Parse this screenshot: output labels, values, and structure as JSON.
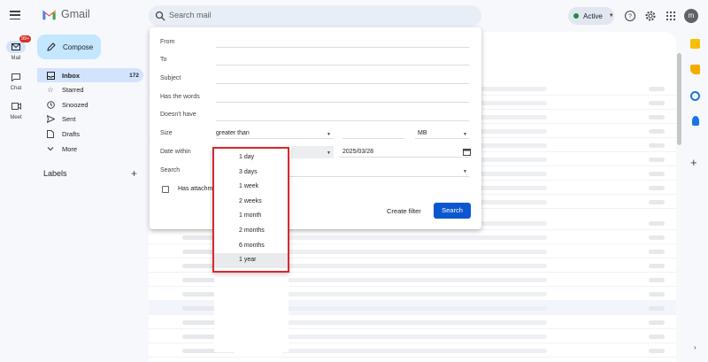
{
  "app": {
    "name": "Gmail"
  },
  "search": {
    "placeholder": "Search mail"
  },
  "status": {
    "label": "Active"
  },
  "account": {
    "initial": "m"
  },
  "rail": [
    {
      "label": "Mail",
      "badge": "99+"
    },
    {
      "label": "Chat"
    },
    {
      "label": "Meet"
    }
  ],
  "compose": {
    "label": "Compose"
  },
  "nav": [
    {
      "label": "Inbox",
      "count": "172",
      "icon": "inbox-icon"
    },
    {
      "label": "Starred",
      "icon": "star-icon"
    },
    {
      "label": "Snoozed",
      "icon": "clock-icon"
    },
    {
      "label": "Sent",
      "icon": "send-icon"
    },
    {
      "label": "Drafts",
      "icon": "draft-icon"
    },
    {
      "label": "More",
      "icon": "chevron-down-icon"
    }
  ],
  "labels": {
    "title": "Labels"
  },
  "advanced": {
    "from": "From",
    "to": "To",
    "subject": "Subject",
    "has_words": "Has the words",
    "doesnt_have": "Doesn't have",
    "size_label": "Size",
    "size_op": "greater than",
    "size_unit": "MB",
    "date_label": "Date within",
    "date_value": "2025/03/28",
    "search_label": "Search",
    "has_attach": "Has attachment",
    "create_filter": "Create filter",
    "search_btn": "Search"
  },
  "date_options": [
    "1 day",
    "3 days",
    "1 week",
    "2 weeks",
    "1 month",
    "2 months",
    "6 months",
    "1 year"
  ],
  "date_selected": "1 year",
  "colors": {
    "accent": "#0b57d0",
    "highlight_border": "#d9272e",
    "selection": "#d3e3fd",
    "compose_bg": "#c2e7ff"
  }
}
